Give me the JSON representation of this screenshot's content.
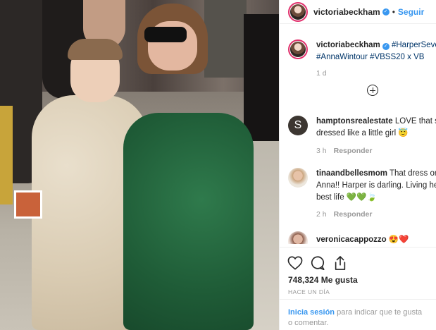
{
  "post": {
    "username": "victoriabeckham",
    "verified_mark": "✓",
    "separator": "•",
    "follow_label": "Seguir"
  },
  "caption": {
    "username": "victoriabeckham",
    "line1": "#HarperSeven",
    "line2": "#AnnaWintour #VBSS20 x VB",
    "age": "1 d"
  },
  "comments": [
    {
      "username": "hamptonsrealestate",
      "line1": "LOVE that she",
      "line2": "dressed like a little girl 😇",
      "age": "3 h",
      "reply": "Responder"
    },
    {
      "username": "tinaandbellesmom",
      "line1": "That dress on",
      "line2": "Anna!! Harper is darling. Living her",
      "line3": "best life 💚💚🍃",
      "age": "2 h",
      "reply": "Responder"
    },
    {
      "username": "veronicacappozzo",
      "line1": "😍❤️"
    }
  ],
  "stats": {
    "likes": "748,324 Me gusta",
    "posted": "HACE UN DÍA"
  },
  "login_prompt": {
    "link": "Inicia sesión",
    "rest": "para indicar que te gusta o comentar."
  },
  "icons": [
    "plus-circle-icon",
    "heart-icon",
    "comment-icon",
    "share-icon",
    "verified-icon"
  ],
  "colors": {
    "link": "#3897f0",
    "hashtag": "#003569",
    "muted": "#999999",
    "story_ring": "#e1306c"
  }
}
